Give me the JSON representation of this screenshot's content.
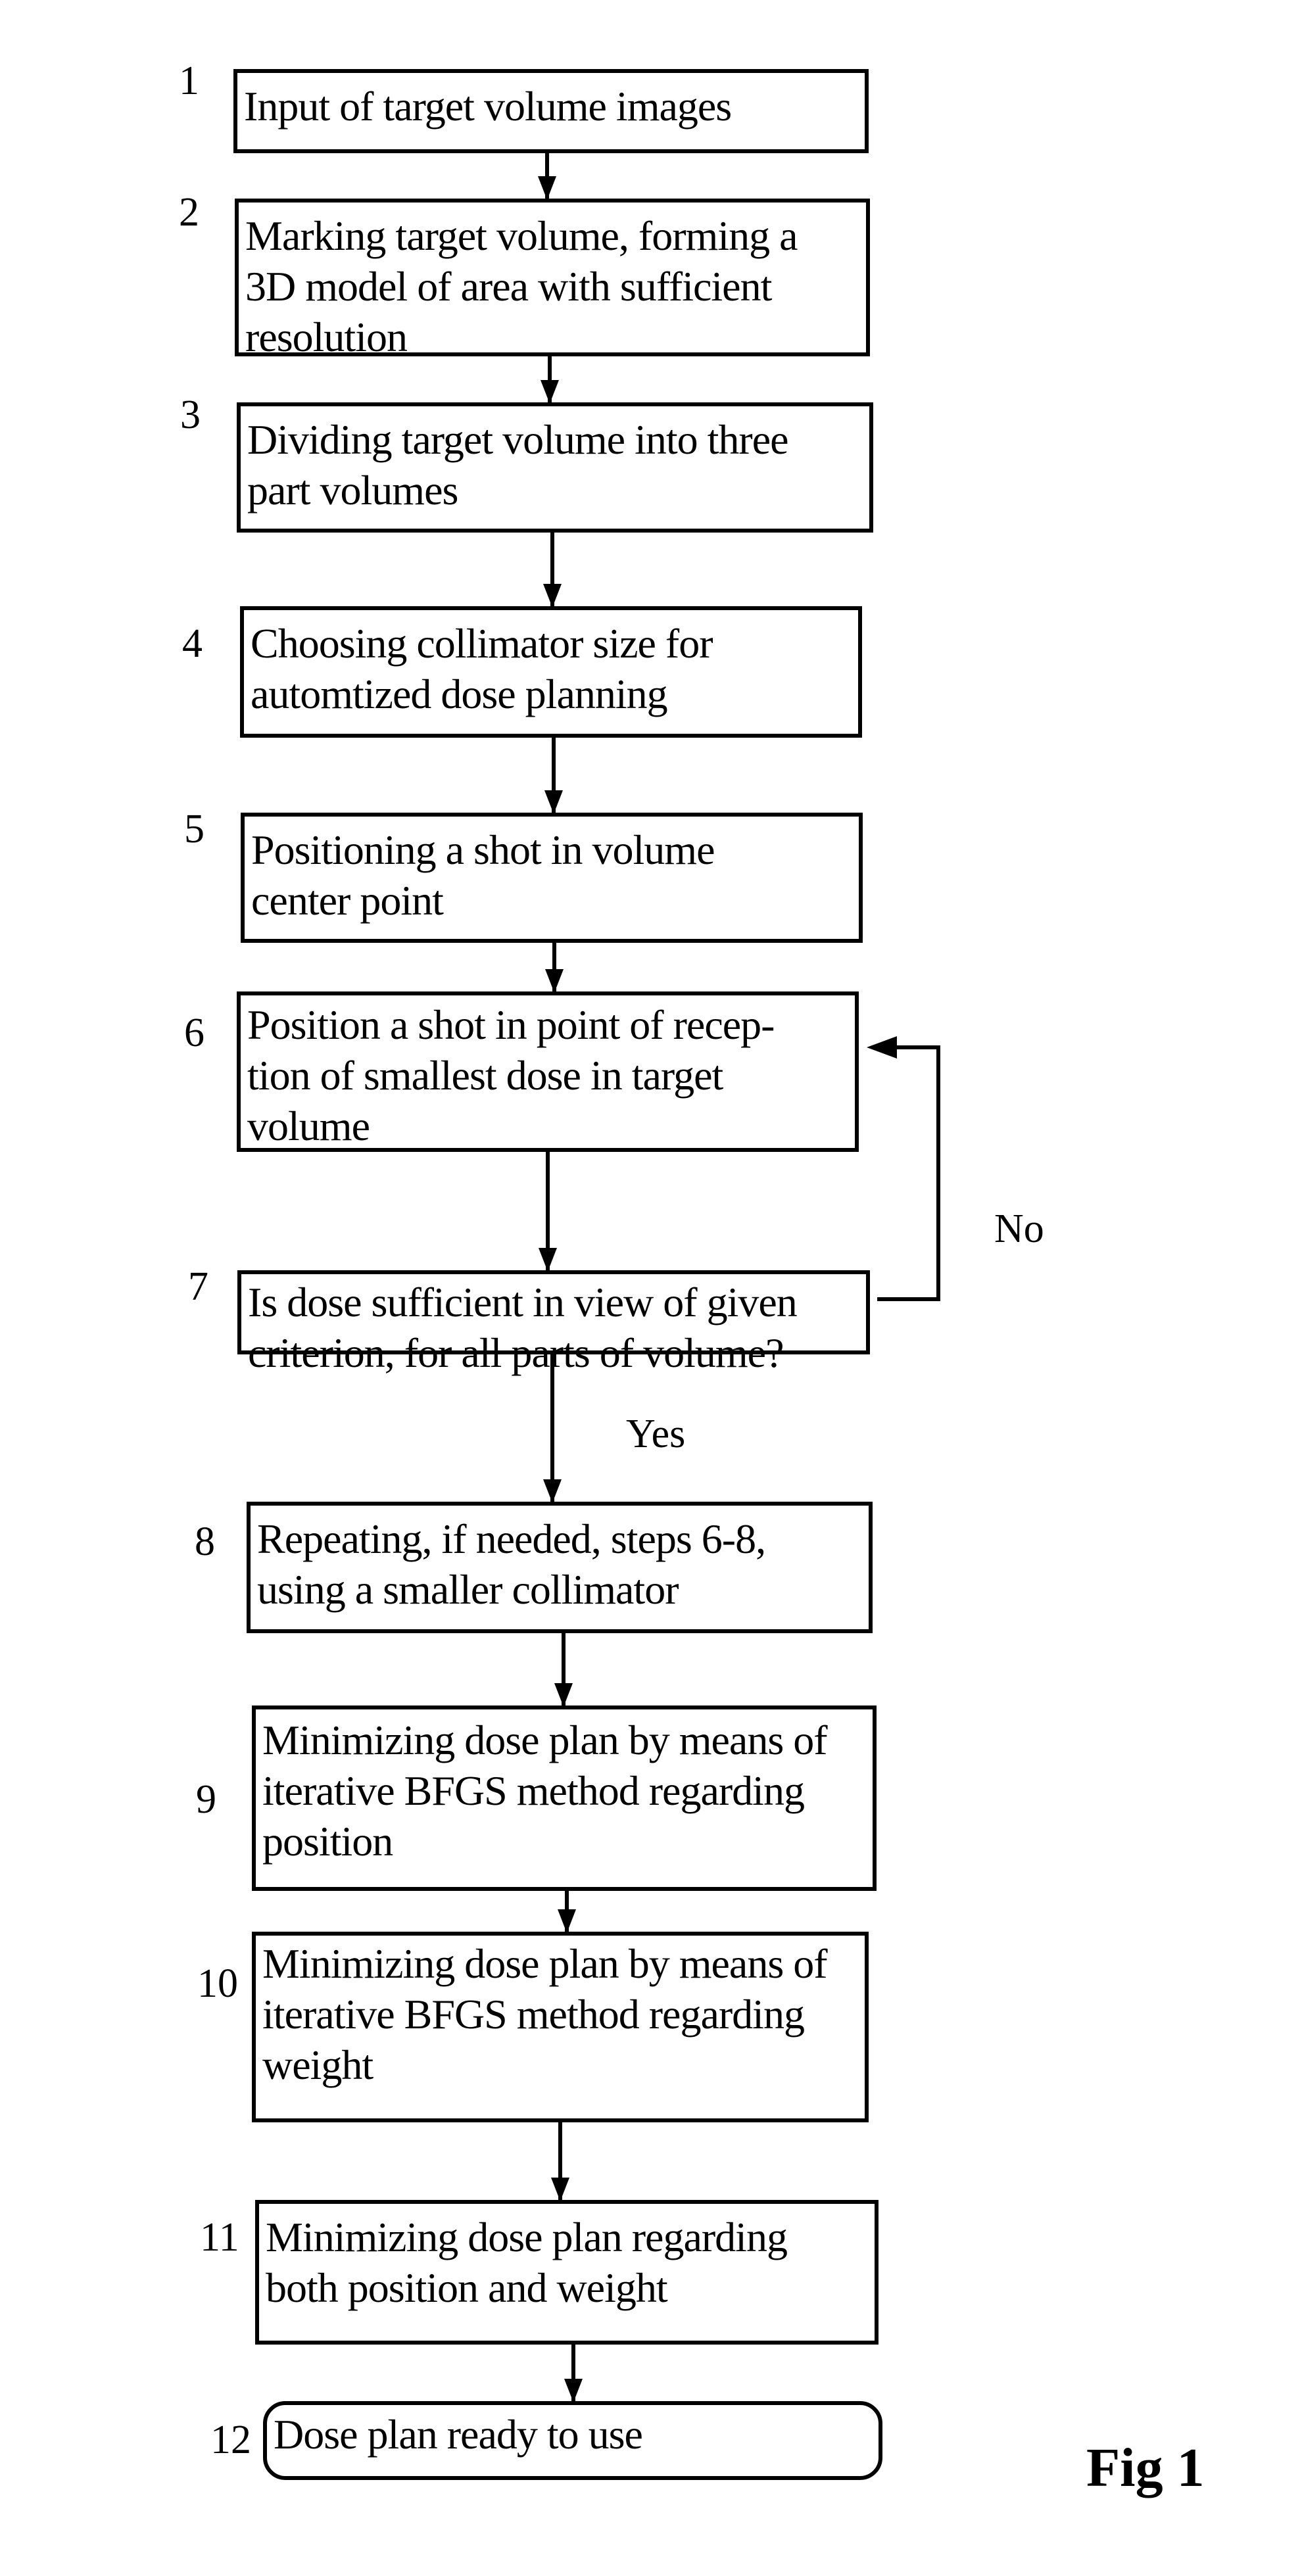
{
  "figure_label": "Fig 1",
  "steps": [
    {
      "number": "1",
      "text": "Input of target volume images"
    },
    {
      "number": "2",
      "text": "Marking target volume, forming a 3D model of area with sufficient resolution"
    },
    {
      "number": "3",
      "text": "Dividing target volume into three part volumes"
    },
    {
      "number": "4",
      "text": "Choosing collimator size for automtized dose planning"
    },
    {
      "number": "5",
      "text": "Positioning a shot in volume center point"
    },
    {
      "number": "6",
      "text": "Position a shot in point of recep-tion of smallest dose in target volume"
    },
    {
      "number": "7",
      "text": "Is dose sufficient in view of given criterion, for all parts of volume?"
    },
    {
      "number": "8",
      "text": "Repeating, if needed, steps 6-8, using a smaller collimator"
    },
    {
      "number": "9",
      "text": "Minimizing dose plan by means of iterative BFGS method regarding position"
    },
    {
      "number": "10",
      "text": "Minimizing dose plan by means of iterative BFGS method regarding weight"
    },
    {
      "number": "11",
      "text": "Minimizing dose plan regarding both position and weight"
    },
    {
      "number": "12",
      "text": "Dose plan ready to use"
    }
  ],
  "lines": {
    "2": [
      "Marking target volume, forming a",
      "3D model of area with sufficient",
      "resolution"
    ],
    "3": [
      "Dividing target volume into three",
      "part volumes"
    ],
    "4": [
      "Choosing collimator size for",
      "automtized dose planning"
    ],
    "5": [
      "Positioning a shot in volume",
      "center point"
    ],
    "6": [
      "Position a shot in point of recep-",
      "tion of smallest dose in target",
      "volume"
    ],
    "7": [
      "Is dose sufficient in view of given",
      "criterion, for all parts of volume?"
    ],
    "8": [
      "Repeating, if needed, steps 6-8,",
      "using a smaller collimator"
    ],
    "9": [
      "Minimizing dose plan by means of",
      "iterative BFGS method regarding",
      "position"
    ],
    "10": [
      "Minimizing dose plan by means of",
      "iterative BFGS method regarding",
      "weight"
    ],
    "11": [
      "Minimizing dose plan regarding",
      "both position and weight"
    ]
  },
  "edges": {
    "yes_label": "Yes",
    "no_label": "No"
  }
}
